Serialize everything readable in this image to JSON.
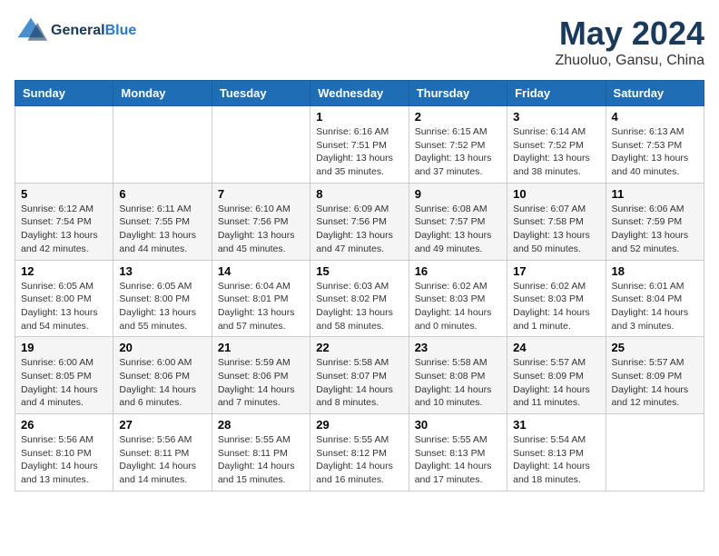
{
  "header": {
    "logo_line1": "General",
    "logo_line2": "Blue",
    "month": "May 2024",
    "location": "Zhuoluo, Gansu, China"
  },
  "weekdays": [
    "Sunday",
    "Monday",
    "Tuesday",
    "Wednesday",
    "Thursday",
    "Friday",
    "Saturday"
  ],
  "weeks": [
    [
      {
        "day": "",
        "sunrise": "",
        "sunset": "",
        "daylight": ""
      },
      {
        "day": "",
        "sunrise": "",
        "sunset": "",
        "daylight": ""
      },
      {
        "day": "",
        "sunrise": "",
        "sunset": "",
        "daylight": ""
      },
      {
        "day": "1",
        "sunrise": "Sunrise: 6:16 AM",
        "sunset": "Sunset: 7:51 PM",
        "daylight": "Daylight: 13 hours and 35 minutes."
      },
      {
        "day": "2",
        "sunrise": "Sunrise: 6:15 AM",
        "sunset": "Sunset: 7:52 PM",
        "daylight": "Daylight: 13 hours and 37 minutes."
      },
      {
        "day": "3",
        "sunrise": "Sunrise: 6:14 AM",
        "sunset": "Sunset: 7:52 PM",
        "daylight": "Daylight: 13 hours and 38 minutes."
      },
      {
        "day": "4",
        "sunrise": "Sunrise: 6:13 AM",
        "sunset": "Sunset: 7:53 PM",
        "daylight": "Daylight: 13 hours and 40 minutes."
      }
    ],
    [
      {
        "day": "5",
        "sunrise": "Sunrise: 6:12 AM",
        "sunset": "Sunset: 7:54 PM",
        "daylight": "Daylight: 13 hours and 42 minutes."
      },
      {
        "day": "6",
        "sunrise": "Sunrise: 6:11 AM",
        "sunset": "Sunset: 7:55 PM",
        "daylight": "Daylight: 13 hours and 44 minutes."
      },
      {
        "day": "7",
        "sunrise": "Sunrise: 6:10 AM",
        "sunset": "Sunset: 7:56 PM",
        "daylight": "Daylight: 13 hours and 45 minutes."
      },
      {
        "day": "8",
        "sunrise": "Sunrise: 6:09 AM",
        "sunset": "Sunset: 7:56 PM",
        "daylight": "Daylight: 13 hours and 47 minutes."
      },
      {
        "day": "9",
        "sunrise": "Sunrise: 6:08 AM",
        "sunset": "Sunset: 7:57 PM",
        "daylight": "Daylight: 13 hours and 49 minutes."
      },
      {
        "day": "10",
        "sunrise": "Sunrise: 6:07 AM",
        "sunset": "Sunset: 7:58 PM",
        "daylight": "Daylight: 13 hours and 50 minutes."
      },
      {
        "day": "11",
        "sunrise": "Sunrise: 6:06 AM",
        "sunset": "Sunset: 7:59 PM",
        "daylight": "Daylight: 13 hours and 52 minutes."
      }
    ],
    [
      {
        "day": "12",
        "sunrise": "Sunrise: 6:05 AM",
        "sunset": "Sunset: 8:00 PM",
        "daylight": "Daylight: 13 hours and 54 minutes."
      },
      {
        "day": "13",
        "sunrise": "Sunrise: 6:05 AM",
        "sunset": "Sunset: 8:00 PM",
        "daylight": "Daylight: 13 hours and 55 minutes."
      },
      {
        "day": "14",
        "sunrise": "Sunrise: 6:04 AM",
        "sunset": "Sunset: 8:01 PM",
        "daylight": "Daylight: 13 hours and 57 minutes."
      },
      {
        "day": "15",
        "sunrise": "Sunrise: 6:03 AM",
        "sunset": "Sunset: 8:02 PM",
        "daylight": "Daylight: 13 hours and 58 minutes."
      },
      {
        "day": "16",
        "sunrise": "Sunrise: 6:02 AM",
        "sunset": "Sunset: 8:03 PM",
        "daylight": "Daylight: 14 hours and 0 minutes."
      },
      {
        "day": "17",
        "sunrise": "Sunrise: 6:02 AM",
        "sunset": "Sunset: 8:03 PM",
        "daylight": "Daylight: 14 hours and 1 minute."
      },
      {
        "day": "18",
        "sunrise": "Sunrise: 6:01 AM",
        "sunset": "Sunset: 8:04 PM",
        "daylight": "Daylight: 14 hours and 3 minutes."
      }
    ],
    [
      {
        "day": "19",
        "sunrise": "Sunrise: 6:00 AM",
        "sunset": "Sunset: 8:05 PM",
        "daylight": "Daylight: 14 hours and 4 minutes."
      },
      {
        "day": "20",
        "sunrise": "Sunrise: 6:00 AM",
        "sunset": "Sunset: 8:06 PM",
        "daylight": "Daylight: 14 hours and 6 minutes."
      },
      {
        "day": "21",
        "sunrise": "Sunrise: 5:59 AM",
        "sunset": "Sunset: 8:06 PM",
        "daylight": "Daylight: 14 hours and 7 minutes."
      },
      {
        "day": "22",
        "sunrise": "Sunrise: 5:58 AM",
        "sunset": "Sunset: 8:07 PM",
        "daylight": "Daylight: 14 hours and 8 minutes."
      },
      {
        "day": "23",
        "sunrise": "Sunrise: 5:58 AM",
        "sunset": "Sunset: 8:08 PM",
        "daylight": "Daylight: 14 hours and 10 minutes."
      },
      {
        "day": "24",
        "sunrise": "Sunrise: 5:57 AM",
        "sunset": "Sunset: 8:09 PM",
        "daylight": "Daylight: 14 hours and 11 minutes."
      },
      {
        "day": "25",
        "sunrise": "Sunrise: 5:57 AM",
        "sunset": "Sunset: 8:09 PM",
        "daylight": "Daylight: 14 hours and 12 minutes."
      }
    ],
    [
      {
        "day": "26",
        "sunrise": "Sunrise: 5:56 AM",
        "sunset": "Sunset: 8:10 PM",
        "daylight": "Daylight: 14 hours and 13 minutes."
      },
      {
        "day": "27",
        "sunrise": "Sunrise: 5:56 AM",
        "sunset": "Sunset: 8:11 PM",
        "daylight": "Daylight: 14 hours and 14 minutes."
      },
      {
        "day": "28",
        "sunrise": "Sunrise: 5:55 AM",
        "sunset": "Sunset: 8:11 PM",
        "daylight": "Daylight: 14 hours and 15 minutes."
      },
      {
        "day": "29",
        "sunrise": "Sunrise: 5:55 AM",
        "sunset": "Sunset: 8:12 PM",
        "daylight": "Daylight: 14 hours and 16 minutes."
      },
      {
        "day": "30",
        "sunrise": "Sunrise: 5:55 AM",
        "sunset": "Sunset: 8:13 PM",
        "daylight": "Daylight: 14 hours and 17 minutes."
      },
      {
        "day": "31",
        "sunrise": "Sunrise: 5:54 AM",
        "sunset": "Sunset: 8:13 PM",
        "daylight": "Daylight: 14 hours and 18 minutes."
      },
      {
        "day": "",
        "sunrise": "",
        "sunset": "",
        "daylight": ""
      }
    ]
  ]
}
